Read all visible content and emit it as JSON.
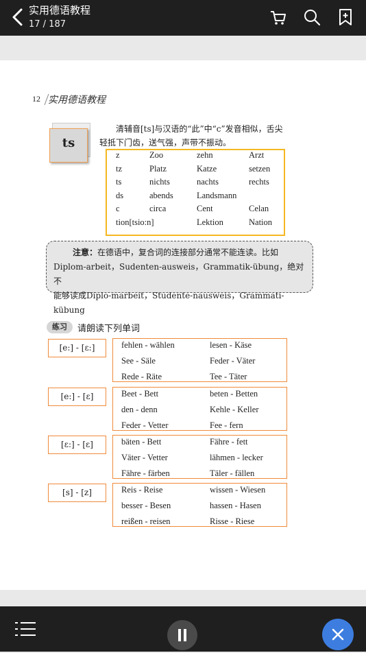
{
  "topbar": {
    "title": "实用德语教程",
    "pager": "17 / 187"
  },
  "page": {
    "header_num": "12",
    "header_title": "实用德语教程",
    "ts_label": "ts",
    "intro_line1": "清辅音[ts]与汉语的“此”中“c”发音相似，舌尖",
    "intro_line2": "轻抵下门齿，送气强，声带不振动。",
    "table": [
      [
        "z",
        "Zoo",
        "zehn",
        "Arzt"
      ],
      [
        "tz",
        "Platz",
        "Katze",
        "setzen"
      ],
      [
        "ts",
        "nichts",
        "nachts",
        "rechts"
      ],
      [
        "ds",
        "abends",
        "Landsmann",
        ""
      ],
      [
        "c",
        "circa",
        "Cent",
        "Celan"
      ],
      [
        "tion[tsio:n]",
        "",
        "Lektion",
        "Nation"
      ]
    ],
    "note": {
      "label": "注意：",
      "line1": "在德语中，复合词的连接部分通常不能连读。比如",
      "line2": "Diplom-arbeit，Sudenten-ausweis，Grammatik-übung，绝对不",
      "line3": "能够读成Diplo-marbeit，Studente-nausweis，Grammati-kübung"
    },
    "exercise": {
      "badge": "练习",
      "title": "请朗读下列单词",
      "groups": [
        {
          "symbol": "[e:] - [ɛ:]",
          "pairs": [
            [
              "fehlen - wählen",
              "lesen - Käse"
            ],
            [
              "See - Säle",
              "Feder - Väter"
            ],
            [
              "Rede - Räte",
              "Tee - Täter"
            ]
          ]
        },
        {
          "symbol": "[e:] - [ɛ]",
          "pairs": [
            [
              "Beet - Bett",
              "beten - Betten"
            ],
            [
              "den - denn",
              "Kehle - Keller"
            ],
            [
              "Feder - Vetter",
              "Fee - fern"
            ]
          ]
        },
        {
          "symbol": "[ɛ:] - [ɛ]",
          "pairs": [
            [
              "bäten - Bett",
              "Fähre - fett"
            ],
            [
              "Väter - Vetter",
              "lähmen - lecker"
            ],
            [
              "Fähre - färben",
              "Täler - fällen"
            ]
          ]
        },
        {
          "symbol": "[s] - [z]",
          "pairs": [
            [
              "Reis - Reise",
              "wissen - Wiesen"
            ],
            [
              "besser - Besen",
              "hassen - Hasen"
            ],
            [
              "reißen - reisen",
              "Risse - Riese"
            ]
          ]
        }
      ]
    }
  },
  "colors": {
    "bar": "#1f1f1f",
    "accent_blue": "#3d7de0",
    "orange": "#f08a3a",
    "yellow": "#f5b820"
  }
}
